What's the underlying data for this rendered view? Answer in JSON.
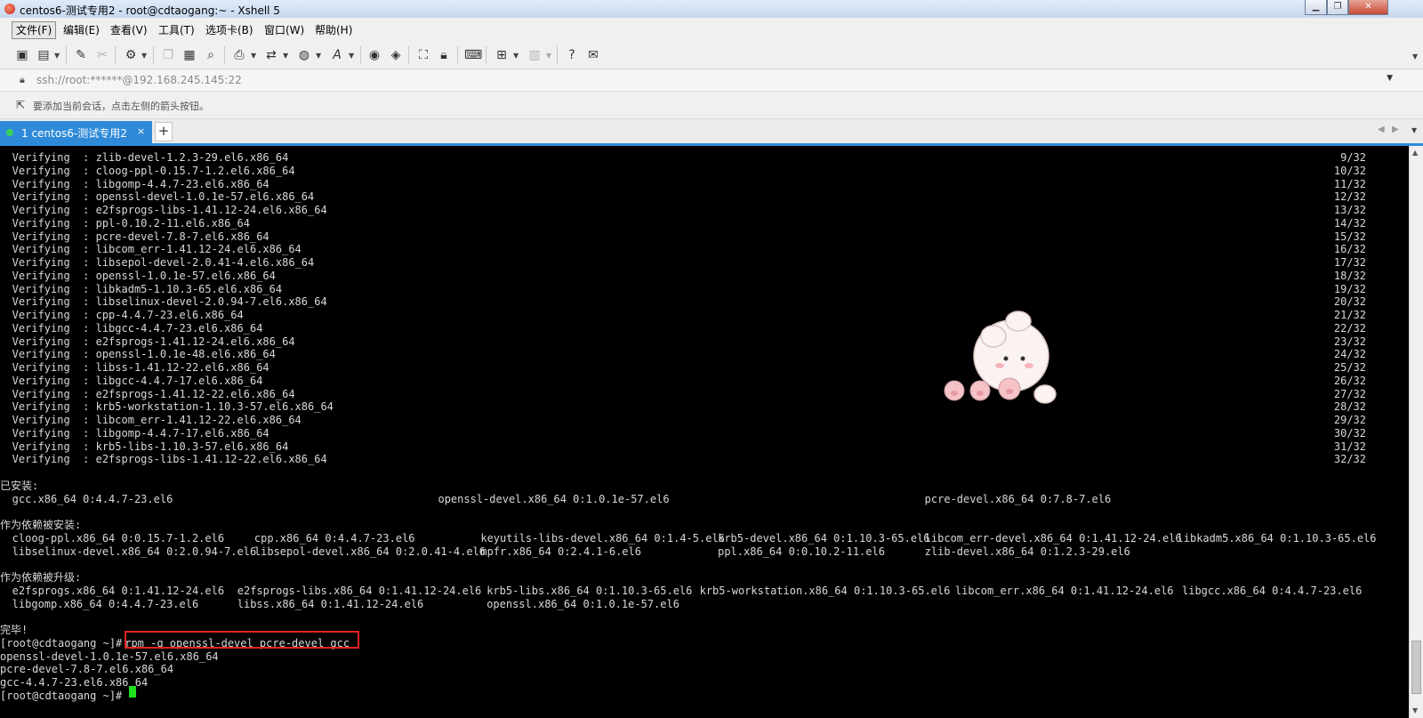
{
  "window": {
    "title": "centos6-测试专用2 - root@cdtaogang:~ - Xshell 5",
    "controls": [
      "▁",
      "❐",
      "✕"
    ]
  },
  "menu": [
    "文件(F)",
    "编辑(E)",
    "查看(V)",
    "工具(T)",
    "选项卡(B)",
    "窗口(W)",
    "帮助(H)"
  ],
  "toolbar_icons": [
    "new-session-icon",
    "open-folder-icon",
    "reconnect-icon",
    "disconnect-icon",
    "properties-icon",
    "copy-icon",
    "paste-icon",
    "find-icon",
    "print-icon",
    "transfer-icon",
    "globe-icon",
    "font-icon",
    "xftp-icon",
    "xmanager-icon",
    "fullscreen-icon",
    "lock-icon",
    "keyboard-icon",
    "compose-icon",
    "layout-icon",
    "help-icon",
    "chat-icon"
  ],
  "address": {
    "text": "ssh://root:******@192.168.245.145:22"
  },
  "session_hint": {
    "text": "要添加当前会话，点击左侧的箭头按钮。"
  },
  "tab": {
    "label": "1 centos6-测试专用2",
    "close": "×",
    "add": "+"
  },
  "terminal": {
    "verifying": [
      {
        "pkg": "Verifying  : zlib-devel-1.2.3-29.el6.x86_64",
        "count": "9/32"
      },
      {
        "pkg": "Verifying  : cloog-ppl-0.15.7-1.2.el6.x86_64",
        "count": "10/32"
      },
      {
        "pkg": "Verifying  : libgomp-4.4.7-23.el6.x86_64",
        "count": "11/32"
      },
      {
        "pkg": "Verifying  : openssl-devel-1.0.1e-57.el6.x86_64",
        "count": "12/32"
      },
      {
        "pkg": "Verifying  : e2fsprogs-libs-1.41.12-24.el6.x86_64",
        "count": "13/32"
      },
      {
        "pkg": "Verifying  : ppl-0.10.2-11.el6.x86_64",
        "count": "14/32"
      },
      {
        "pkg": "Verifying  : pcre-devel-7.8-7.el6.x86_64",
        "count": "15/32"
      },
      {
        "pkg": "Verifying  : libcom_err-1.41.12-24.el6.x86_64",
        "count": "16/32"
      },
      {
        "pkg": "Verifying  : libsepol-devel-2.0.41-4.el6.x86_64",
        "count": "17/32"
      },
      {
        "pkg": "Verifying  : openssl-1.0.1e-57.el6.x86_64",
        "count": "18/32"
      },
      {
        "pkg": "Verifying  : libkadm5-1.10.3-65.el6.x86_64",
        "count": "19/32"
      },
      {
        "pkg": "Verifying  : libselinux-devel-2.0.94-7.el6.x86_64",
        "count": "20/32"
      },
      {
        "pkg": "Verifying  : cpp-4.4.7-23.el6.x86_64",
        "count": "21/32"
      },
      {
        "pkg": "Verifying  : libgcc-4.4.7-23.el6.x86_64",
        "count": "22/32"
      },
      {
        "pkg": "Verifying  : e2fsprogs-1.41.12-24.el6.x86_64",
        "count": "23/32"
      },
      {
        "pkg": "Verifying  : openssl-1.0.1e-48.el6.x86_64",
        "count": "24/32"
      },
      {
        "pkg": "Verifying  : libss-1.41.12-22.el6.x86_64",
        "count": "25/32"
      },
      {
        "pkg": "Verifying  : libgcc-4.4.7-17.el6.x86_64",
        "count": "26/32"
      },
      {
        "pkg": "Verifying  : e2fsprogs-1.41.12-22.el6.x86_64",
        "count": "27/32"
      },
      {
        "pkg": "Verifying  : krb5-workstation-1.10.3-57.el6.x86_64",
        "count": "28/32"
      },
      {
        "pkg": "Verifying  : libcom_err-1.41.12-22.el6.x86_64",
        "count": "29/32"
      },
      {
        "pkg": "Verifying  : libgomp-4.4.7-17.el6.x86_64",
        "count": "30/32"
      },
      {
        "pkg": "Verifying  : krb5-libs-1.10.3-57.el6.x86_64",
        "count": "31/32"
      },
      {
        "pkg": "Verifying  : e2fsprogs-libs-1.41.12-22.el6.x86_64",
        "count": "32/32"
      }
    ],
    "installed_header": "已安装:",
    "installed": [
      "gcc.x86_64 0:4.4.7-23.el6",
      "openssl-devel.x86_64 0:1.0.1e-57.el6",
      "pcre-devel.x86_64 0:7.8-7.el6"
    ],
    "dep_installed_header": "作为依赖被安装:",
    "dep_installed": [
      [
        "cloog-ppl.x86_64 0:0.15.7-1.2.el6",
        "cpp.x86_64 0:4.4.7-23.el6",
        "keyutils-libs-devel.x86_64 0:1.4-5.el6",
        "krb5-devel.x86_64 0:1.10.3-65.el6",
        "libcom_err-devel.x86_64 0:1.41.12-24.el6",
        "libkadm5.x86_64 0:1.10.3-65.el6"
      ],
      [
        "libselinux-devel.x86_64 0:2.0.94-7.el6",
        "libsepol-devel.x86_64 0:2.0.41-4.el6",
        "mpfr.x86_64 0:2.4.1-6.el6",
        "ppl.x86_64 0:0.10.2-11.el6",
        "zlib-devel.x86_64 0:1.2.3-29.el6"
      ]
    ],
    "dep_updated_header": "作为依赖被升级:",
    "dep_updated": [
      [
        "e2fsprogs.x86_64 0:1.41.12-24.el6",
        "e2fsprogs-libs.x86_64 0:1.41.12-24.el6",
        "krb5-libs.x86_64 0:1.10.3-65.el6",
        "krb5-workstation.x86_64 0:1.10.3-65.el6",
        "libcom_err.x86_64 0:1.41.12-24.el6",
        "libgcc.x86_64 0:4.4.7-23.el6"
      ],
      [
        "libgomp.x86_64 0:4.4.7-23.el6",
        "libss.x86_64 0:1.41.12-24.el6",
        "openssl.x86_64 0:1.0.1e-57.el6"
      ]
    ],
    "complete": "完毕!",
    "prompt": "[root@cdtaogang ~]# ",
    "command": "rpm -q openssl-devel pcre-devel gcc",
    "output": [
      "openssl-devel-1.0.1e-57.el6.x86_64",
      "pcre-devel-7.8-7.el6.x86_64",
      "gcc-4.4.7-23.el6.x86_64"
    ],
    "final_prompt": "[root@cdtaogang ~]# "
  },
  "colors": {
    "terminal_bg": "#000000",
    "terminal_text": "#d8d8d8",
    "cursor": "#1ee01e",
    "highlight": "#e8251b",
    "tab_active": "#2e8ad8"
  }
}
